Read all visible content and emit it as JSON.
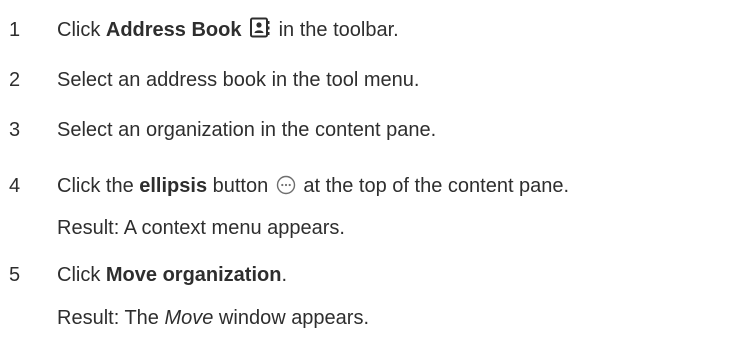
{
  "steps": [
    {
      "number": "1",
      "pre": "Click ",
      "bold": "Address Book",
      "post": " in the toolbar.",
      "icon": "address-book-icon"
    },
    {
      "number": "2",
      "text": "Select an address book in the tool menu."
    },
    {
      "number": "3",
      "text": "Select an organization in the content pane."
    },
    {
      "number": "4",
      "pre": "Click the ",
      "bold": "ellipsis",
      "mid": " button ",
      "post": " at the top of the content pane.",
      "icon": "ellipsis-icon",
      "result": "Result: A context menu appears."
    },
    {
      "number": "5",
      "pre": "Click ",
      "bold": "Move organization",
      "post": ".",
      "result_pre": "Result: The ",
      "result_italic": "Move",
      "result_post": " window appears."
    }
  ]
}
